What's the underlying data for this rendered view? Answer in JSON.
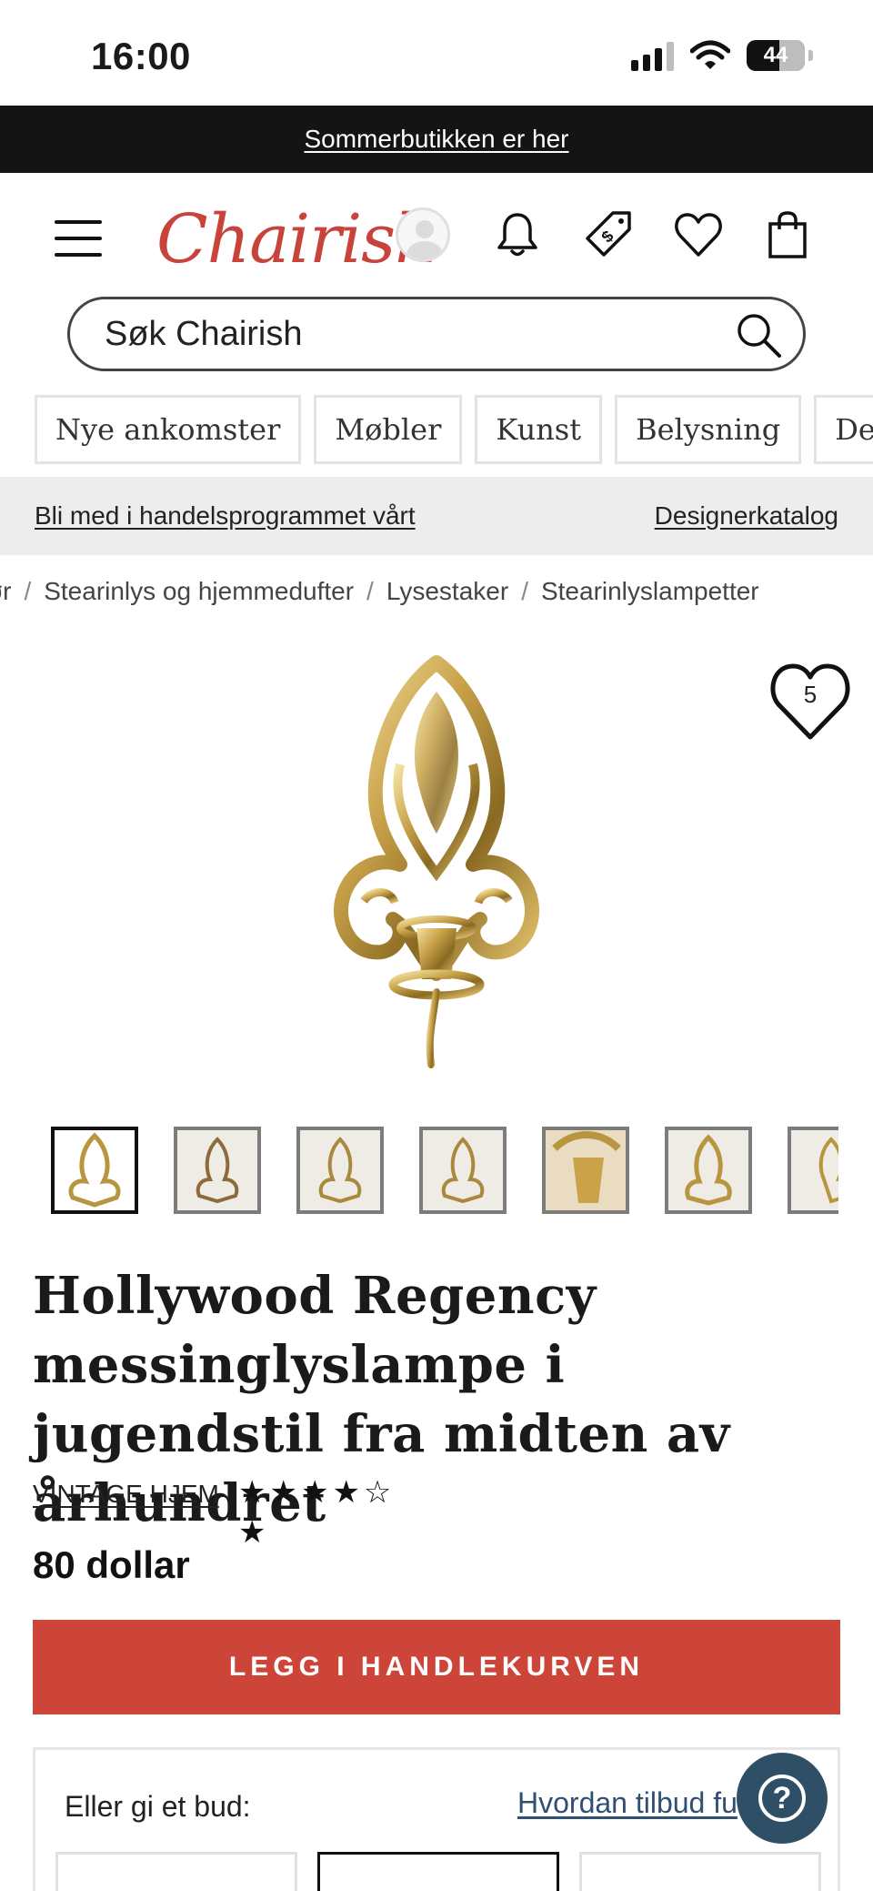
{
  "status_bar": {
    "time": "16:00",
    "battery": "44"
  },
  "promo": {
    "link": "Sommerbutikken er her"
  },
  "header": {
    "logo": "Chairish"
  },
  "search": {
    "placeholder": "Søk Chairish"
  },
  "categories": [
    "Nye ankomster",
    "Møbler",
    "Kunst",
    "Belysning",
    "Deko"
  ],
  "trade_bar": {
    "left_link": "Bli med i handelsprogrammet vårt",
    "right_link": "Designerkatalog"
  },
  "breadcrumb": [
    "ør",
    "Stearinlys og hjemmedufter",
    "Lysestaker",
    "Stearinlyslampetter"
  ],
  "favorites": {
    "count": "5"
  },
  "product": {
    "title": "Hollywood Regency messinglyslampe i jugendstil fra midten av århundret",
    "seller": "VINTAGE HJEM",
    "rating": {
      "value": 4,
      "max": 5,
      "display": "★★★★☆\n★"
    },
    "price": "80 dollar"
  },
  "cta": {
    "label": "LEGG I HANDLEKURVEN"
  },
  "offer": {
    "label": "Eller gi et bud:",
    "how_link": "Hvordan tilbud fu"
  },
  "help": {
    "label": "?"
  },
  "colors": {
    "accent": "#cd4438",
    "logo": "#c8443b",
    "promo_bg": "#141414",
    "help_bg": "#2f4f66"
  }
}
